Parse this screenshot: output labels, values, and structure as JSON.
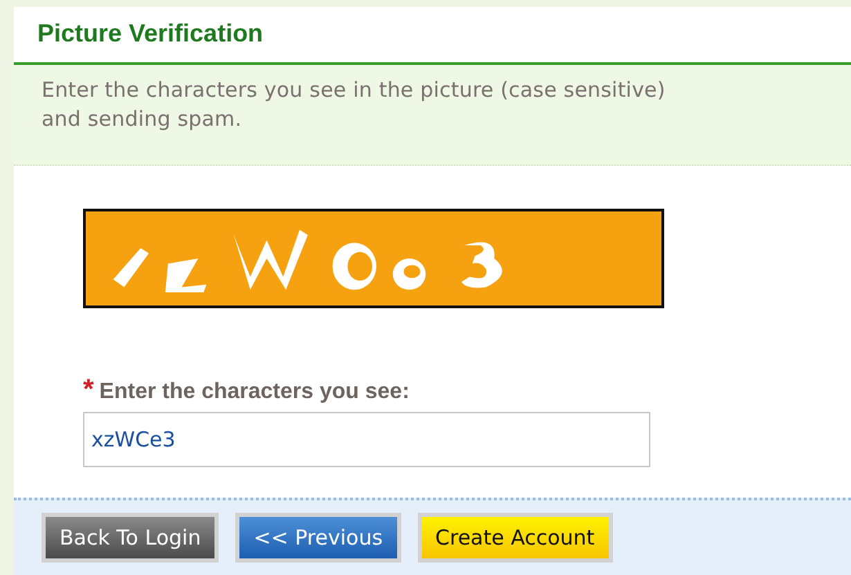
{
  "section": {
    "title": "Picture Verification"
  },
  "instructions": [
    "Enter the characters you see in the picture (case sensitive)",
    "and sending spam."
  ],
  "captcha": {
    "kind": "picture"
  },
  "field": {
    "label": "Enter the characters you see:",
    "required_mark": "*",
    "value": "xzWCe3"
  },
  "buttons": [
    {
      "label": "Back To Login",
      "kind": "dark"
    },
    {
      "label": "<< Previous",
      "kind": "blue"
    },
    {
      "label": "Create Account",
      "kind": "yellow"
    }
  ]
}
